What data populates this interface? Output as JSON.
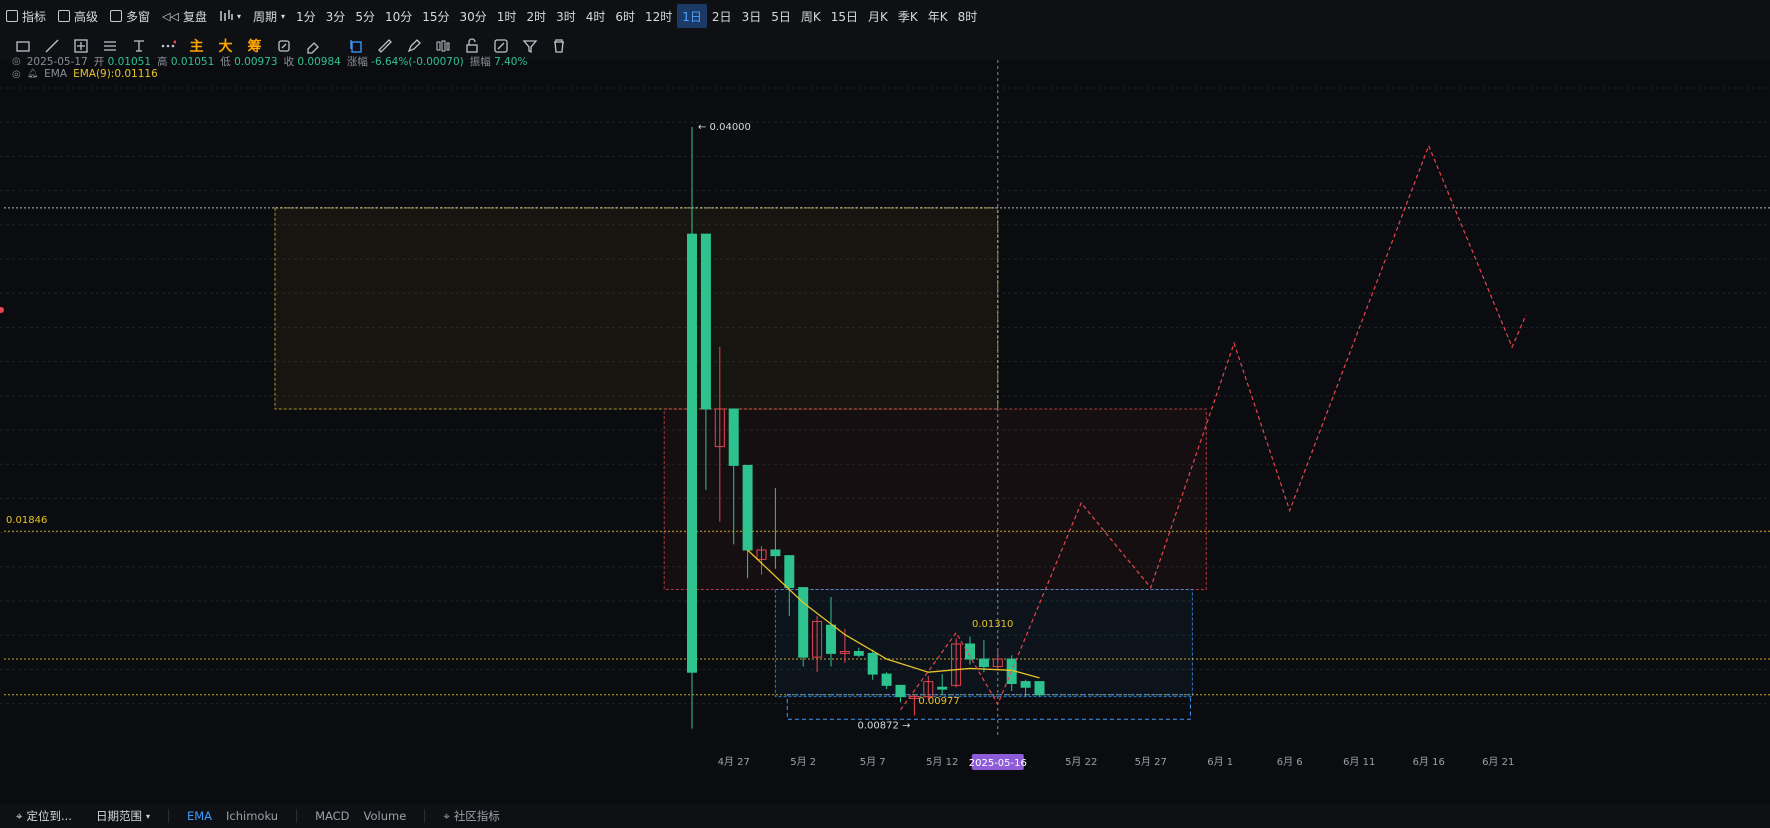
{
  "toolbar": {
    "indicators": "指标",
    "advanced": "高级",
    "multi_window": "多窗",
    "replay": "复盘",
    "period_label": "周期",
    "intervals": [
      "1分",
      "3分",
      "5分",
      "10分",
      "15分",
      "30分",
      "1时",
      "2时",
      "3时",
      "4时",
      "6时",
      "12时",
      "1日",
      "2日",
      "3日",
      "5日",
      "周K",
      "15日",
      "月K",
      "季K",
      "年K",
      "8时"
    ],
    "active_interval": "1日"
  },
  "drawing_tools": {
    "main_label": "主",
    "big_label": "大",
    "chip_label": "筹",
    "tools": [
      "rectangle-icon",
      "line-icon",
      "crosshair-box-icon",
      "parallel-lines-icon",
      "text-tool-icon",
      "more-icon",
      "main-force-label",
      "big-order-label",
      "chip-label",
      "magnet-icon",
      "eraser-icon",
      "copy-icon",
      "ruler-icon",
      "pen-icon",
      "bars-icon",
      "lock-icon",
      "pencil-brush-icon",
      "filter-icon",
      "trash-icon"
    ]
  },
  "ohlc_info": {
    "date": "2025-05-17",
    "open_label": "开",
    "open": "0.01051",
    "high_label": "高",
    "high": "0.01051",
    "low_label": "低",
    "low": "0.00973",
    "close_label": "收",
    "close": "0.00984",
    "change_label": "涨幅",
    "change": "-6.64%(-0.00070)",
    "amplitude_label": "振幅",
    "amplitude": "7.40%"
  },
  "ema_info": {
    "label": "EMA",
    "value_text": "EMA(9):0.01116"
  },
  "chart_data": {
    "type": "candlestick",
    "title": "",
    "xlabel": "",
    "ylabel": "",
    "x_tick_labels": [
      "4月 27",
      "5月 2",
      "5月 7",
      "5月 12",
      "5月 22",
      "5月 27",
      "6月 1",
      "6月 6",
      "6月 11",
      "6月 16",
      "6月 21"
    ],
    "crosshair_date_label": "2025-05-16",
    "ylim": [
      0.0075,
      0.0425
    ],
    "colors": {
      "up": "#e5464f",
      "down": "#2ec28e",
      "ema": "#e6c229",
      "projection": "#e5464f",
      "level": "#e6c229"
    },
    "candles": [
      {
        "date": "2025-04-24",
        "open": 0.011,
        "high": 0.04,
        "low": 0.008,
        "close": 0.0343,
        "dir": "down-wick"
      },
      {
        "date": "2025-04-25",
        "open": 0.0343,
        "high": 0.033,
        "low": 0.0207,
        "close": 0.025,
        "dir": "down"
      },
      {
        "date": "2025-04-26",
        "open": 0.025,
        "high": 0.0283,
        "low": 0.019,
        "close": 0.023,
        "dir": "up"
      },
      {
        "date": "2025-04-27",
        "open": 0.025,
        "high": 0.025,
        "low": 0.0178,
        "close": 0.022,
        "dir": "down"
      },
      {
        "date": "2025-04-28",
        "open": 0.022,
        "high": 0.022,
        "low": 0.016,
        "close": 0.0175,
        "dir": "down"
      },
      {
        "date": "2025-04-29",
        "open": 0.017,
        "high": 0.0177,
        "low": 0.0162,
        "close": 0.0175,
        "dir": "up"
      },
      {
        "date": "2025-04-30",
        "open": 0.0175,
        "high": 0.0208,
        "low": 0.0165,
        "close": 0.0172,
        "dir": "down"
      },
      {
        "date": "2025-05-01",
        "open": 0.0172,
        "high": 0.0172,
        "low": 0.014,
        "close": 0.0155,
        "dir": "down"
      },
      {
        "date": "2025-05-02",
        "open": 0.0155,
        "high": 0.0155,
        "low": 0.0113,
        "close": 0.0118,
        "dir": "down"
      },
      {
        "date": "2025-05-03",
        "open": 0.0118,
        "high": 0.014,
        "low": 0.011,
        "close": 0.0137,
        "dir": "up"
      },
      {
        "date": "2025-05-04",
        "open": 0.0135,
        "high": 0.015,
        "low": 0.0113,
        "close": 0.012,
        "dir": "down"
      },
      {
        "date": "2025-05-05",
        "open": 0.012,
        "high": 0.0133,
        "low": 0.0115,
        "close": 0.0121,
        "dir": "up"
      },
      {
        "date": "2025-05-06",
        "open": 0.0121,
        "high": 0.0123,
        "low": 0.0118,
        "close": 0.0119,
        "dir": "down"
      },
      {
        "date": "2025-05-07",
        "open": 0.012,
        "high": 0.0122,
        "low": 0.0106,
        "close": 0.0109,
        "dir": "down"
      },
      {
        "date": "2025-05-08",
        "open": 0.0109,
        "high": 0.011,
        "low": 0.0101,
        "close": 0.0103,
        "dir": "down"
      },
      {
        "date": "2025-05-09",
        "open": 0.0103,
        "high": 0.0103,
        "low": 0.0094,
        "close": 0.0097,
        "dir": "down"
      },
      {
        "date": "2025-05-10",
        "open": 0.0097,
        "high": 0.0098,
        "low": 0.0087,
        "close": 0.0096,
        "dir": "up"
      },
      {
        "date": "2025-05-11",
        "open": 0.0097,
        "high": 0.0108,
        "low": 0.0095,
        "close": 0.0105,
        "dir": "up"
      },
      {
        "date": "2025-05-12",
        "open": 0.0102,
        "high": 0.0109,
        "low": 0.0098,
        "close": 0.0101,
        "dir": "down"
      },
      {
        "date": "2025-05-13",
        "open": 0.0103,
        "high": 0.0128,
        "low": 0.0102,
        "close": 0.0125,
        "dir": "up"
      },
      {
        "date": "2025-05-14",
        "open": 0.0125,
        "high": 0.0129,
        "low": 0.0114,
        "close": 0.0117,
        "dir": "down"
      },
      {
        "date": "2025-05-15",
        "open": 0.0117,
        "high": 0.0127,
        "low": 0.011,
        "close": 0.0113,
        "dir": "down"
      },
      {
        "date": "2025-05-16",
        "open": 0.0113,
        "high": 0.0122,
        "low": 0.0111,
        "close": 0.0117,
        "dir": "up"
      },
      {
        "date": "2025-05-17",
        "open": 0.0117,
        "high": 0.0119,
        "low": 0.01,
        "close": 0.0104,
        "dir": "down"
      },
      {
        "date": "2025-05-18",
        "open": 0.0105,
        "high": 0.0106,
        "low": 0.0097,
        "close": 0.0102,
        "dir": "down"
      },
      {
        "date": "2025-05-19",
        "open": 0.0105,
        "high": 0.0105,
        "low": 0.0097,
        "close": 0.0098,
        "dir": "down"
      }
    ],
    "ema9": [
      {
        "date": "2025-04-28",
        "value": 0.0175
      },
      {
        "date": "2025-05-02",
        "value": 0.0147
      },
      {
        "date": "2025-05-05",
        "value": 0.013
      },
      {
        "date": "2025-05-08",
        "value": 0.0117
      },
      {
        "date": "2025-05-11",
        "value": 0.011
      },
      {
        "date": "2025-05-14",
        "value": 0.0112
      },
      {
        "date": "2025-05-17",
        "value": 0.0111
      },
      {
        "date": "2025-05-19",
        "value": 0.0107
      }
    ],
    "price_labels": {
      "high": "0.04000",
      "low": "0.00872",
      "level": "0.01846",
      "swing_high": "0.01310",
      "swing_low": "0.00977"
    },
    "levels": [
      {
        "value": 0.0357,
        "style": "dotted-white"
      },
      {
        "value": 0.0185,
        "style": "dotted-yellow"
      },
      {
        "value": 0.0117,
        "style": "dotted-yellow"
      },
      {
        "value": 0.0098,
        "style": "dotted-yellow"
      }
    ],
    "zones": [
      {
        "from_date": "2025-03-25",
        "to_date": "2025-05-16",
        "low": 0.025,
        "high": 0.0357,
        "color": "#e6c229"
      },
      {
        "from_date": "2025-04-22",
        "to_date": "2025-05-31",
        "low": 0.0154,
        "high": 0.025,
        "color": "#e5464f"
      },
      {
        "from_date": "2025-04-30",
        "to_date": "2025-05-30",
        "low": 0.0097,
        "high": 0.0154,
        "color": "#3b9cff"
      }
    ],
    "projection": [
      {
        "date": "2025-05-09",
        "value": 0.009
      },
      {
        "date": "2025-05-13",
        "value": 0.0131
      },
      {
        "date": "2025-05-16",
        "value": 0.0093
      },
      {
        "date": "2025-05-22",
        "value": 0.02
      },
      {
        "date": "2025-05-27",
        "value": 0.0155
      },
      {
        "date": "2025-06-02",
        "value": 0.0285
      },
      {
        "date": "2025-06-06",
        "value": 0.0196
      },
      {
        "date": "2025-06-16",
        "value": 0.039
      },
      {
        "date": "2025-06-22",
        "value": 0.0283
      },
      {
        "date": "2025-06-23",
        "value": 0.03
      }
    ],
    "grid": true,
    "legend": "top-left"
  },
  "footer": {
    "locate": "定位到...",
    "date_range": "日期范围",
    "tabs": [
      "EMA",
      "Ichimoku",
      "MACD",
      "Volume",
      "社区指标"
    ]
  }
}
